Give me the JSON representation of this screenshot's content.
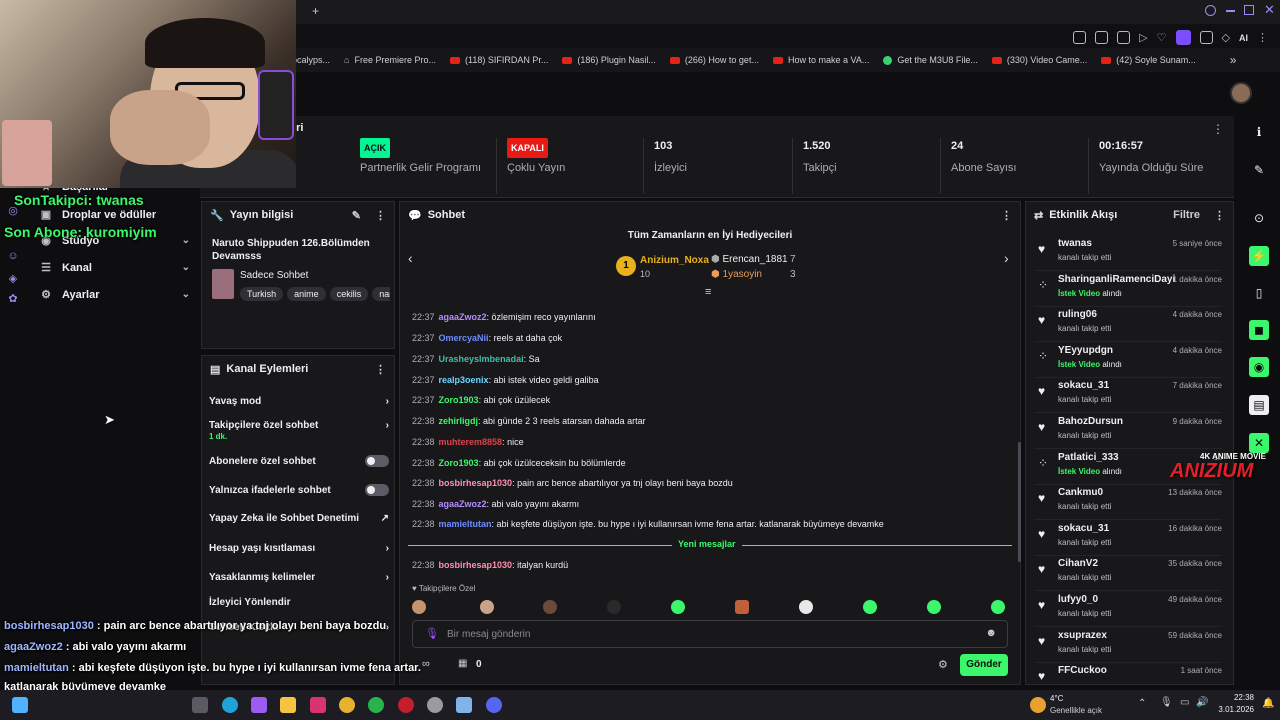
{
  "browser": {
    "new_tab": "+",
    "bookmarks": [
      {
        "label": "ocalyps...",
        "icon": "none"
      },
      {
        "label": "Free Premiere Pro...",
        "icon": "link"
      },
      {
        "label": "(118) SIFIRDAN Pr...",
        "icon": "youtube"
      },
      {
        "label": "(186) Plugin Nasil...",
        "icon": "youtube"
      },
      {
        "label": "(266) How to get...",
        "icon": "youtube"
      },
      {
        "label": "How to make a VA...",
        "icon": "youtube"
      },
      {
        "label": "Get the M3U8 File...",
        "icon": "green"
      },
      {
        "label": "(330) Video Came...",
        "icon": "youtube"
      },
      {
        "label": "(42) Soyle Sunam...",
        "icon": "youtube"
      }
    ],
    "more": "»",
    "ai_label": "AI"
  },
  "overlay": {
    "son_takipci": "SonTakipci: twanas",
    "son_abone": "Son Abone: kuromiyim",
    "chat_lines": [
      {
        "user": "bosbirhesap1030",
        "text": " : pain arc bence abartılıyor ya tnj olayı beni baya bozdu"
      },
      {
        "user": "agaaZwoz2",
        "text": " : abi valo yayını akarmı"
      },
      {
        "user": "mamieltutan",
        "text": " : abi keşfete düşüyon işte. bu hype ı iyi kullanırsan ivme fena artar."
      },
      {
        "user": "",
        "text": "katlanarak büyümeye devamke"
      },
      {
        "user": "bosbirhesap1030",
        "text": " : italyan kurdü"
      }
    ],
    "logo_caption": "4K ANIME MOVIE",
    "logo_text": "ANIZIUM"
  },
  "left_nav": {
    "items": [
      {
        "label": "Başarılar",
        "icon": "star-icon"
      },
      {
        "label": "Droplar ve ödüller",
        "icon": "gift-icon"
      },
      {
        "label": "Stüdyo",
        "icon": "studio-icon"
      },
      {
        "label": "Kanal",
        "icon": "channel-icon"
      },
      {
        "label": "Ayarlar",
        "icon": "gear-icon"
      }
    ],
    "partial_header": "eri"
  },
  "stats": [
    {
      "value": "AÇIK",
      "label": "Partnerlik Gelir Programı",
      "kind": "on"
    },
    {
      "value": "KAPALI",
      "label": "Çoklu Yayın",
      "kind": "off"
    },
    {
      "value": "103",
      "label": "İzleyici",
      "kind": "num"
    },
    {
      "value": "1.520",
      "label": "Takipçi",
      "kind": "num"
    },
    {
      "value": "24",
      "label": "Abone Sayısı",
      "kind": "num"
    },
    {
      "value": "00:16:57",
      "label": "Yayında Olduğu Süre",
      "kind": "num"
    }
  ],
  "stream_info": {
    "header": "Yayın bilgisi",
    "title": "Naruto Shippuden 126.Bölümden Devamsss",
    "category": "Sadece Sohbet",
    "tags": [
      "Turkish",
      "anime",
      "cekilis",
      "naru"
    ]
  },
  "channel_actions": {
    "header": "Kanal Eylemleri",
    "rows": [
      {
        "label": "Yavaş mod",
        "sub": "",
        "control": "chevron"
      },
      {
        "label": "Takipçilere özel sohbet",
        "sub": "1 dk.",
        "control": "chevron"
      },
      {
        "label": "Abonelere özel sohbet",
        "sub": "",
        "control": "toggle"
      },
      {
        "label": "Yalnızca ifadelerle sohbet",
        "sub": "",
        "control": "toggle"
      },
      {
        "label": "Yapay Zeka ile Sohbet Denetimi",
        "sub": "",
        "control": "external"
      },
      {
        "label": "Hesap yaşı kısıtlaması",
        "sub": "",
        "control": "chevron"
      },
      {
        "label": "Yasaklanmış kelimeler",
        "sub": "",
        "control": "chevron"
      },
      {
        "label": "İzleyici Yönlendir",
        "sub": "",
        "control": "none"
      },
      {
        "label": "Sohbeti Kısıtla",
        "sub": "",
        "control": "chevron"
      }
    ]
  },
  "chat": {
    "header": "Sohbet",
    "top_gifters_title": "Tüm Zamanların en İyi Hediyecileri",
    "gifters": [
      {
        "rank": "1",
        "name": "Anizium_Noxa",
        "count": "10"
      },
      {
        "rank": "",
        "name": "Erencan_1881",
        "count": "7"
      },
      {
        "rank": "",
        "name": "1yasoyin",
        "count": "3"
      }
    ],
    "messages": [
      {
        "time": "22:37",
        "user": "agaaZwoz2",
        "color": "#b58cff",
        "text": ": özlemişim reco yayınlarını"
      },
      {
        "time": "22:37",
        "user": "OmercyaNii",
        "color": "#6f8cff",
        "text": ": reels at daha çok"
      },
      {
        "time": "22:37",
        "user": "Urasheyslmbenadai",
        "color": "#3fbfa5",
        "text": ": Sa"
      },
      {
        "time": "22:37",
        "user": "realp3oenix",
        "color": "#6fd4ff",
        "text": ": abi istek video geldi galiba"
      },
      {
        "time": "22:37",
        "user": "Zoro1903",
        "color": "#3cf76b",
        "text": ": abi çok üzülecek"
      },
      {
        "time": "22:38",
        "user": "zehirligdj",
        "color": "#3cf76b",
        "text": ": abi günde 2 3 reels atarsan dahada artar"
      },
      {
        "time": "22:38",
        "user": "muhterem8858",
        "color": "#e0414b",
        "text": ": nice"
      },
      {
        "time": "22:38",
        "user": "Zoro1903",
        "color": "#3cf76b",
        "text": ": abi çok üzülceceksin bu bölümlerde"
      },
      {
        "time": "22:38",
        "user": "bosbirhesap1030",
        "color": "#ff8fb3",
        "text": ": pain arc bence abartılıyor ya tnj olayı beni baya bozdu"
      },
      {
        "time": "22:38",
        "user": "agaaZwoz2",
        "color": "#b58cff",
        "text": ": abi valo yayını akarmı"
      },
      {
        "time": "22:38",
        "user": "mamieltutan",
        "color": "#6f8cff",
        "text": ": abi keşfete düşüyon işte. bu hype ı iyi kullanırsan ivme fena artar. katlanarak büyümeye devamke"
      }
    ],
    "new_messages_label": "Yeni mesajlar",
    "after_messages": [
      {
        "time": "22:38",
        "user": "bosbirhesap1030",
        "color": "#ff8fb3",
        "text": ": italyan kurdü"
      }
    ],
    "followers_only_label": "Takipçilere Özel",
    "input_placeholder": "Bir mesaj gönderin",
    "points_value": "0",
    "send_label": "Gönder"
  },
  "activity": {
    "header": "Etkinlik Akışı",
    "filter_label": "Filtre",
    "events": [
      {
        "name": "twanas",
        "sub": "kanalı takip etti",
        "time": "5 saniye önce",
        "type": "follow"
      },
      {
        "name": "SharinganliRamenciDayi",
        "sub": "alındı",
        "time": "1 dakika önce",
        "type": "reward"
      },
      {
        "name": "ruling06",
        "sub": "kanalı takip etti",
        "time": "4 dakika önce",
        "type": "follow"
      },
      {
        "name": "YEyyupdgn",
        "sub": "alındı",
        "time": "4 dakika önce",
        "type": "reward"
      },
      {
        "name": "sokacu_31",
        "sub": "kanalı takip etti",
        "time": "7 dakika önce",
        "type": "follow"
      },
      {
        "name": "BahozDursun",
        "sub": "kanalı takip etti",
        "time": "9 dakika önce",
        "type": "follow"
      },
      {
        "name": "Patlatici_333",
        "sub": "alındı",
        "time": "11",
        "type": "reward"
      },
      {
        "name": "Cankmu0",
        "sub": "kanalı takip etti",
        "time": "13 dakika önce",
        "type": "follow"
      },
      {
        "name": "sokacu_31",
        "sub": "kanalı takip etti",
        "time": "16 dakika önce",
        "type": "follow"
      },
      {
        "name": "CihanV2",
        "sub": "kanalı takip etti",
        "time": "35 dakika önce",
        "type": "follow"
      },
      {
        "name": "lufyy0_0",
        "sub": "kanalı takip etti",
        "time": "49 dakika önce",
        "type": "follow"
      },
      {
        "name": "xsuprazex",
        "sub": "kanalı takip etti",
        "time": "59 dakika önce",
        "type": "follow"
      },
      {
        "name": "FFCuckoo",
        "sub": "",
        "time": "1 saat önce",
        "type": "follow"
      }
    ],
    "istek_video": "İstek Video"
  },
  "taskbar": {
    "weather_temp": "4°C",
    "weather_text": "Genellikle açık",
    "time": "22:38",
    "date": "3.01.2026"
  }
}
